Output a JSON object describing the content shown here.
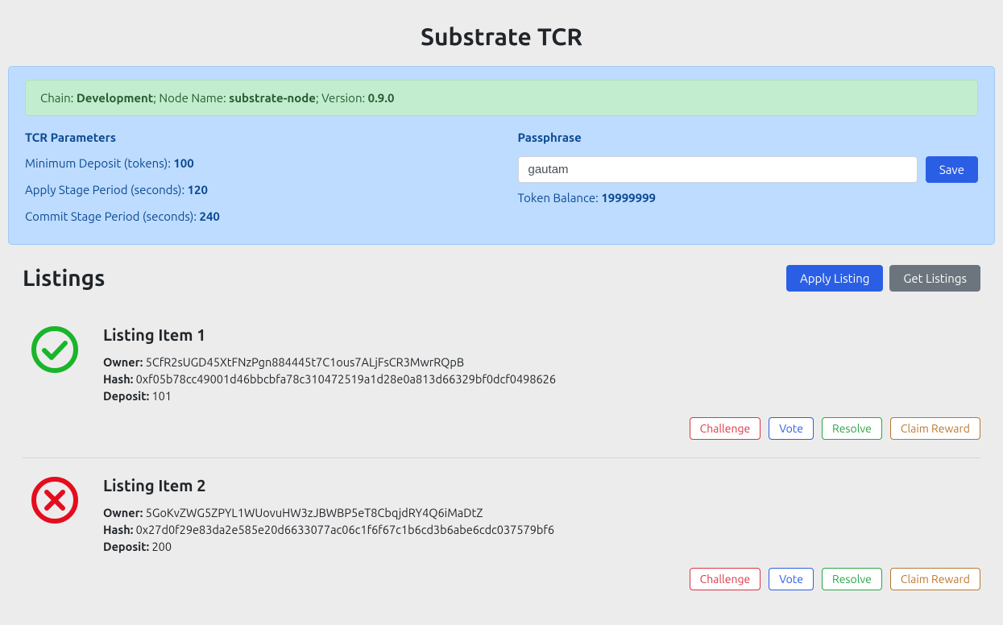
{
  "title": "Substrate TCR",
  "status": {
    "chain_label": "Chain:",
    "chain_value": "Development",
    "node_label": "; Node Name:",
    "node_value": "substrate-node",
    "version_label": "; Version:",
    "version_value": "0.9.0"
  },
  "params": {
    "heading": "TCR Parameters",
    "min_deposit_label": "Minimum Deposit (tokens):",
    "min_deposit_value": "100",
    "apply_period_label": "Apply Stage Period (seconds):",
    "apply_period_value": "120",
    "commit_period_label": "Commit Stage Period (seconds):",
    "commit_period_value": "240"
  },
  "passphrase": {
    "heading": "Passphrase",
    "value": "gautam",
    "save_label": "Save",
    "balance_label": "Token Balance:",
    "balance_value": "19999999"
  },
  "listings": {
    "heading": "Listings",
    "apply_label": "Apply Listing",
    "get_label": "Get Listings",
    "action_challenge": "Challenge",
    "action_vote": "Vote",
    "action_resolve": "Resolve",
    "action_claim": "Claim Reward",
    "owner_label": "Owner:",
    "hash_label": "Hash:",
    "deposit_label": "Deposit:",
    "items": [
      {
        "status": "accepted",
        "name": "Listing Item 1",
        "owner": "5CfR2sUGD45XtFNzPgn884445t7C1ous7ALjFsCR3MwrRQpB",
        "hash": "0xf05b78cc49001d46bbcbfa78c310472519a1d28e0a813d66329bf0dcf0498626",
        "deposit": "101"
      },
      {
        "status": "rejected",
        "name": "Listing Item 2",
        "owner": "5GoKvZWG5ZPYL1WUovuHW3zJBWBP5eT8CbqjdRY4Q6iMaDtZ",
        "hash": "0x27d0f29e83da2e585e20d6633077ac06c1f6f67c1b6cd3b6abe6cdc037579bf6",
        "deposit": "200"
      }
    ]
  }
}
